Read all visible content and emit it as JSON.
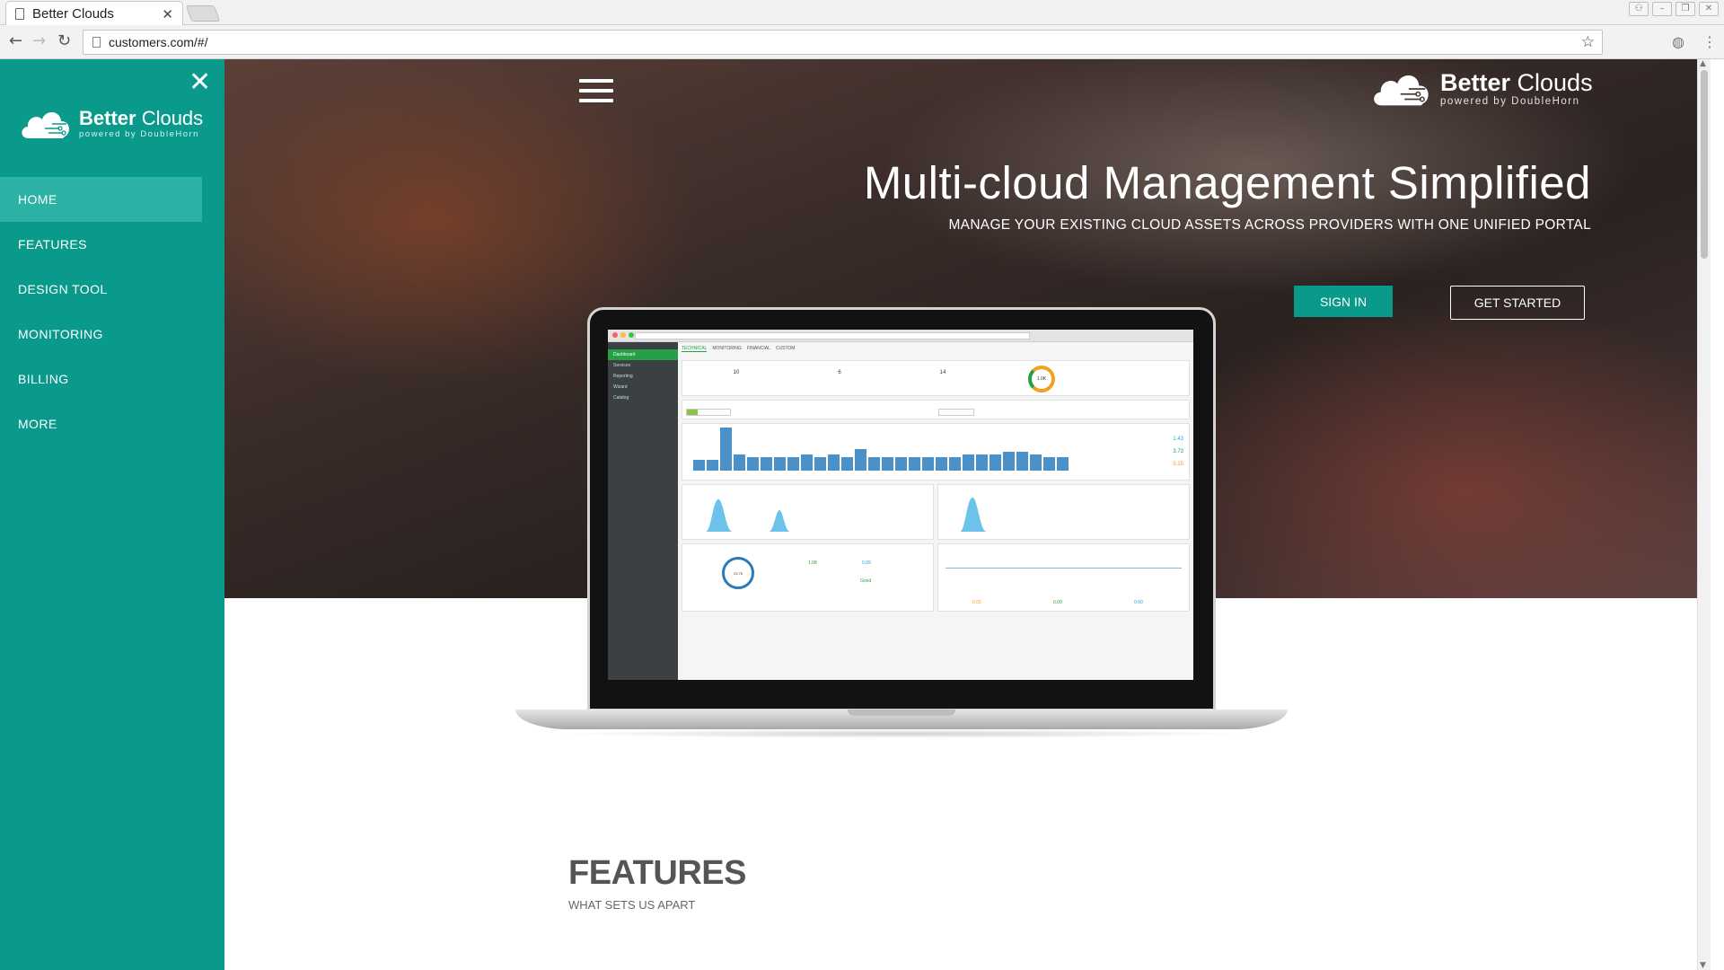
{
  "browser": {
    "tab_title": "Better Clouds",
    "tab_close": "✕",
    "url": "customers.com/#/",
    "back": "←",
    "forward": "→",
    "reload": "↻",
    "star": "☆",
    "menu": "⋮",
    "window_buttons": [
      "⚇",
      "–",
      "❐",
      "✕"
    ]
  },
  "sidebar": {
    "close": "✕",
    "logo": {
      "bold": "Better",
      "rest": " Clouds",
      "tagline": "powered by DoubleHorn"
    },
    "items": [
      {
        "label": "HOME"
      },
      {
        "label": "FEATURES"
      },
      {
        "label": "DESIGN TOOL"
      },
      {
        "label": "MONITORING"
      },
      {
        "label": "BILLING"
      },
      {
        "label": "MORE"
      }
    ]
  },
  "hero": {
    "logo": {
      "bold": "Better",
      "rest": " Clouds",
      "tagline": "powered by DoubleHorn"
    },
    "title": "Multi-cloud Management Simplified",
    "subtitle": "MANAGE YOUR EXISTING CLOUD ASSETS ACROSS PROVIDERS WITH ONE UNIFIED PORTAL",
    "signin_label": "SIGN IN",
    "get_started_label": "GET STARTED"
  },
  "screenshot": {
    "side_items": [
      "Dashboard",
      "Services",
      "Reporting",
      "Wizard",
      "Catalog"
    ],
    "tabs": [
      "TECHNICAL",
      "MONITORING",
      "FINANCIAL",
      "CUSTOM"
    ],
    "stats": [
      "10",
      "6",
      "14"
    ],
    "donut_value": "1.0K",
    "ring_value": "23.75",
    "bar_values": [
      4,
      4,
      16,
      6,
      5,
      5,
      5,
      5,
      6,
      5,
      6,
      5,
      8,
      5,
      5,
      5,
      5,
      5,
      5,
      5,
      6,
      6,
      6,
      7,
      7,
      6,
      5,
      5
    ],
    "side_numbers": [
      "1.43",
      "3.73",
      "5.15"
    ],
    "totals": [
      "0.00",
      "0.00",
      "0.00"
    ],
    "ops": [
      "1.08",
      "0.99",
      "Good"
    ]
  },
  "features": {
    "title": "FEATURES",
    "subtitle": "WHAT SETS US APART"
  },
  "colors": {
    "brand": "#0a9a8c",
    "brand_light": "#2bb2a4",
    "chart_blue": "#4a90c9",
    "green": "#25a046"
  }
}
